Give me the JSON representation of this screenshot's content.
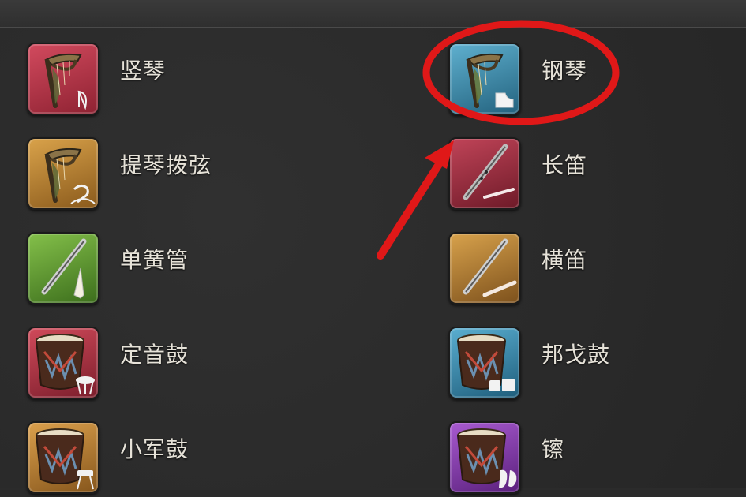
{
  "instruments": {
    "harp": {
      "label": "竖琴",
      "icon": "harp-icon",
      "color": "#b8374b"
    },
    "piano": {
      "label": "钢琴",
      "icon": "piano-icon",
      "color": "#3c8fb2"
    },
    "lute": {
      "label": "提琴拨弦",
      "icon": "lute-icon",
      "color": "#c28933"
    },
    "fife": {
      "label": "长笛",
      "icon": "fife-icon",
      "color": "#9b2e40"
    },
    "clarinet": {
      "label": "单簧管",
      "icon": "clarinet-icon",
      "color": "#68a23a"
    },
    "flute": {
      "label": "横笛",
      "icon": "flute-icon",
      "color": "#bf8a35"
    },
    "timpani": {
      "label": "定音鼓",
      "icon": "timpani-icon",
      "color": "#b23a48"
    },
    "bongo": {
      "label": "邦戈鼓",
      "icon": "bongo-icon",
      "color": "#3c93b8"
    },
    "snare": {
      "label": "小军鼓",
      "icon": "snare-drum-icon",
      "color": "#c98f37"
    },
    "cymbal": {
      "label": "镲",
      "icon": "cymbal-icon",
      "color": "#8a3fb0"
    }
  },
  "annotation": {
    "circle_color": "#e01818",
    "arrow_color": "#e01818"
  }
}
